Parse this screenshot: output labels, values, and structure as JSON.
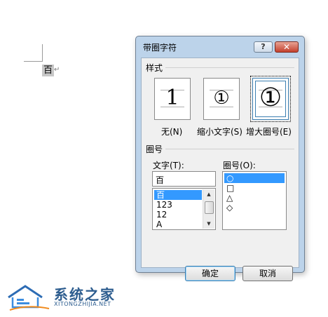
{
  "document": {
    "character": "百",
    "paragraph_mark": "↵"
  },
  "dialog": {
    "title": "带圈字符",
    "help_button": "?",
    "close_button": "✕",
    "style_section": {
      "label": "样式",
      "options": [
        {
          "sample": "1",
          "label": "无(N)",
          "selected": false
        },
        {
          "sample": "①",
          "label": "缩小文字(S)",
          "selected": false
        },
        {
          "sample": "①",
          "label": "增大圈号(E)",
          "selected": true
        }
      ]
    },
    "circle_section": {
      "label": "圈号",
      "text_label": "文字(T):",
      "text_value": "百",
      "text_list": [
        "百",
        "123",
        "12",
        "A"
      ],
      "text_list_selected": "百",
      "enclosure_label": "圈号(O):",
      "enclosure_list": [
        "○",
        "□",
        "△",
        "◇"
      ],
      "enclosure_selected": "○"
    },
    "ok_button": "确定",
    "cancel_button": "取消"
  },
  "watermark": {
    "brand": "系统之家",
    "url": "XITONGZHIJIA.NET"
  }
}
